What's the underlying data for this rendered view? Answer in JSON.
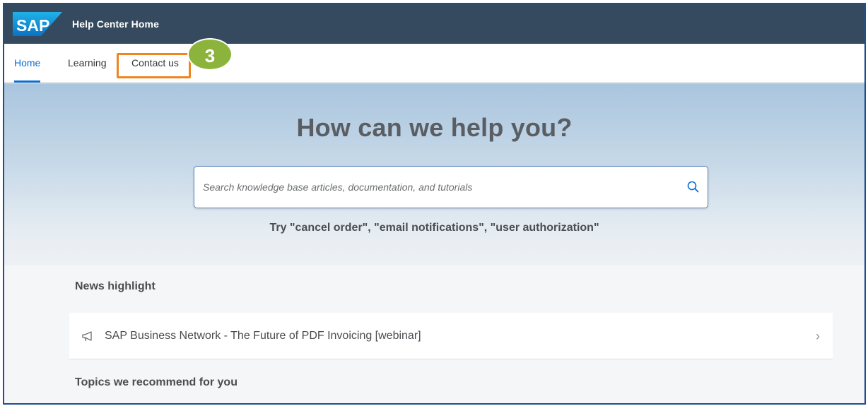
{
  "shell": {
    "logo_text": "SAP",
    "title": "Help Center Home"
  },
  "tabs": [
    {
      "label": "Home",
      "active": true
    },
    {
      "label": "Learning",
      "active": false
    },
    {
      "label": "Contact us",
      "active": false
    }
  ],
  "callout": {
    "step_number": "3"
  },
  "hero": {
    "title": "How can we help you?",
    "search_placeholder": "Search knowledge base articles, documentation, and tutorials",
    "search_value": "",
    "try_text": "Try  \"cancel order\", \"email notifications\", \"user authorization\""
  },
  "news": {
    "heading": "News highlight",
    "items": [
      {
        "icon": "megaphone-icon",
        "text": "SAP Business Network - The Future of PDF Invoicing [webinar]"
      }
    ]
  },
  "topics": {
    "heading": "Topics we recommend for you"
  },
  "colors": {
    "shellbar": "#354a5f",
    "accent": "#0a6ed1",
    "highlight": "#f0851e",
    "badge": "#8cb43c",
    "frame_border": "#1f4e8f"
  }
}
